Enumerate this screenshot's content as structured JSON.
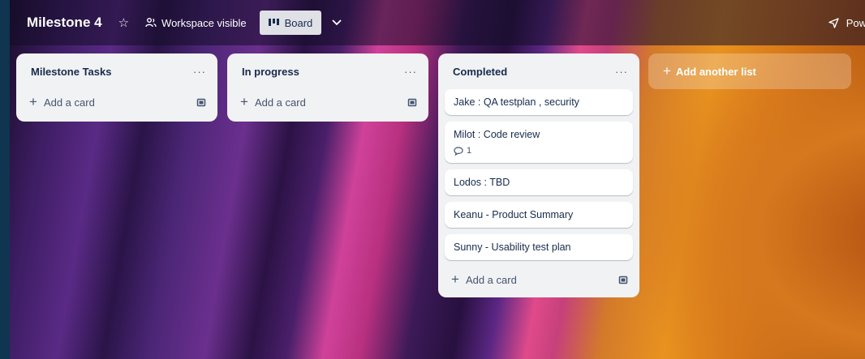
{
  "board": {
    "title": "Milestone 4",
    "visibility_label": "Workspace visible",
    "view_label": "Board",
    "power_ups_label": "Pow"
  },
  "lists": [
    {
      "name": "Milestone Tasks",
      "menu_label": "···",
      "add_card_label": "Add a card",
      "cards": []
    },
    {
      "name": "In progress",
      "menu_label": "···",
      "add_card_label": "Add a card",
      "cards": []
    },
    {
      "name": "Completed",
      "menu_label": "···",
      "add_card_label": "Add a card",
      "cards": [
        {
          "title": "Jake : QA testplan , security"
        },
        {
          "title": "Milot : Code review",
          "comments": "1"
        },
        {
          "title": "Lodos : TBD"
        },
        {
          "title": "Keanu - Product Summary"
        },
        {
          "title": "Sunny - Usability test plan"
        }
      ]
    }
  ],
  "add_list_label": "Add another list",
  "icons": {
    "star": "star-icon",
    "workspace": "people-icon",
    "board": "board-icon",
    "chevron": "chevron-down-icon",
    "power_ups": "rocket-icon",
    "template": "card-template-icon",
    "comment": "comment-icon"
  }
}
